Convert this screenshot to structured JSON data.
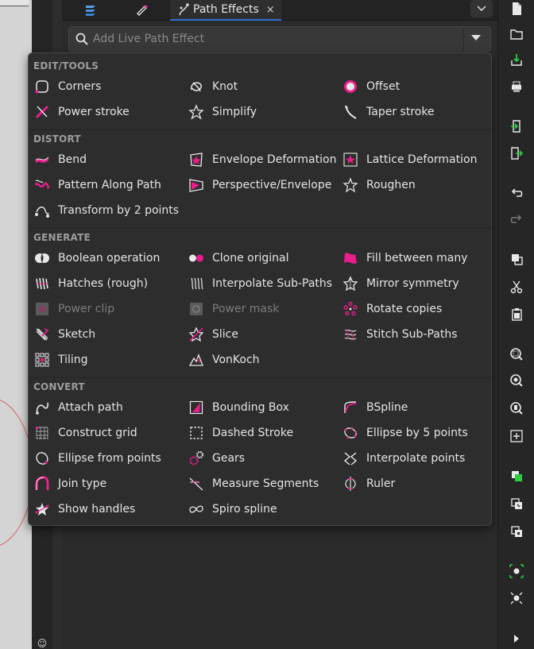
{
  "colors": {
    "accent": "#e91e8c",
    "tab_underline": "#2e6fd6",
    "text": "#e4e4e4",
    "muted": "#9c9c9c"
  },
  "tabs": {
    "active_label": "Path Effects",
    "close_glyph": "×"
  },
  "search": {
    "placeholder": "Add Live Path Effect"
  },
  "sections": [
    {
      "title": "EDIT/TOOLS",
      "items": [
        {
          "label": "Corners",
          "icon": "corners-icon"
        },
        {
          "label": "Knot",
          "icon": "knot-icon"
        },
        {
          "label": "Offset",
          "icon": "offset-icon"
        },
        {
          "label": "Power stroke",
          "icon": "power-stroke-icon"
        },
        {
          "label": "Simplify",
          "icon": "simplify-icon"
        },
        {
          "label": "Taper stroke",
          "icon": "taper-stroke-icon"
        }
      ]
    },
    {
      "title": "DISTORT",
      "items": [
        {
          "label": "Bend",
          "icon": "bend-icon"
        },
        {
          "label": "Envelope Deformation",
          "icon": "envelope-deformation-icon"
        },
        {
          "label": "Lattice Deformation",
          "icon": "lattice-deformation-icon"
        },
        {
          "label": "Pattern Along Path",
          "icon": "pattern-along-path-icon"
        },
        {
          "label": "Perspective/Envelope",
          "icon": "perspective-envelope-icon"
        },
        {
          "label": "Roughen",
          "icon": "roughen-icon"
        },
        {
          "label": "Transform by 2 points",
          "icon": "transform-2pts-icon"
        }
      ]
    },
    {
      "title": "GENERATE",
      "items": [
        {
          "label": "Boolean operation",
          "icon": "boolean-operation-icon"
        },
        {
          "label": "Clone original",
          "icon": "clone-original-icon"
        },
        {
          "label": "Fill between many",
          "icon": "fill-between-many-icon"
        },
        {
          "label": "Hatches (rough)",
          "icon": "hatches-icon"
        },
        {
          "label": "Interpolate Sub-Paths",
          "icon": "interpolate-subpaths-icon"
        },
        {
          "label": "Mirror symmetry",
          "icon": "mirror-symmetry-icon"
        },
        {
          "label": "Power clip",
          "icon": "power-clip-icon",
          "disabled": true
        },
        {
          "label": "Power mask",
          "icon": "power-mask-icon",
          "disabled": true
        },
        {
          "label": "Rotate copies",
          "icon": "rotate-copies-icon"
        },
        {
          "label": "Sketch",
          "icon": "sketch-icon"
        },
        {
          "label": "Slice",
          "icon": "slice-icon"
        },
        {
          "label": "Stitch Sub-Paths",
          "icon": "stitch-subpaths-icon"
        },
        {
          "label": "Tiling",
          "icon": "tiling-icon"
        },
        {
          "label": "VonKoch",
          "icon": "vonkoch-icon"
        }
      ]
    },
    {
      "title": "CONVERT",
      "items": [
        {
          "label": "Attach path",
          "icon": "attach-path-icon"
        },
        {
          "label": "Bounding Box",
          "icon": "bounding-box-icon"
        },
        {
          "label": "BSpline",
          "icon": "bspline-icon"
        },
        {
          "label": "Construct grid",
          "icon": "construct-grid-icon"
        },
        {
          "label": "Dashed Stroke",
          "icon": "dashed-stroke-icon"
        },
        {
          "label": "Ellipse by 5 points",
          "icon": "ellipse-5pts-icon"
        },
        {
          "label": "Ellipse from points",
          "icon": "ellipse-from-points-icon"
        },
        {
          "label": "Gears",
          "icon": "gears-icon"
        },
        {
          "label": "Interpolate points",
          "icon": "interpolate-points-icon"
        },
        {
          "label": "Join type",
          "icon": "join-type-icon"
        },
        {
          "label": "Measure Segments",
          "icon": "measure-segments-icon"
        },
        {
          "label": "Ruler",
          "icon": "ruler-icon"
        },
        {
          "label": "Show handles",
          "icon": "show-handles-icon"
        },
        {
          "label": "Spiro spline",
          "icon": "spiro-spline-icon"
        }
      ]
    }
  ],
  "right_toolbar": [
    "new-document-icon",
    "open-folder-icon",
    "save-icon",
    "print-icon",
    "import-icon",
    "export-icon",
    "undo-icon",
    "redo-icon",
    "copy-icon",
    "cut-icon",
    "paste-icon",
    "zoom-selection-icon",
    "zoom-drawing-icon",
    "zoom-page-icon",
    "zoom-center-icon",
    "duplicate-icon",
    "clone-icon",
    "unlink-clone-icon",
    "group-icon",
    "ungroup-icon",
    "expand-toolbar-icon"
  ]
}
